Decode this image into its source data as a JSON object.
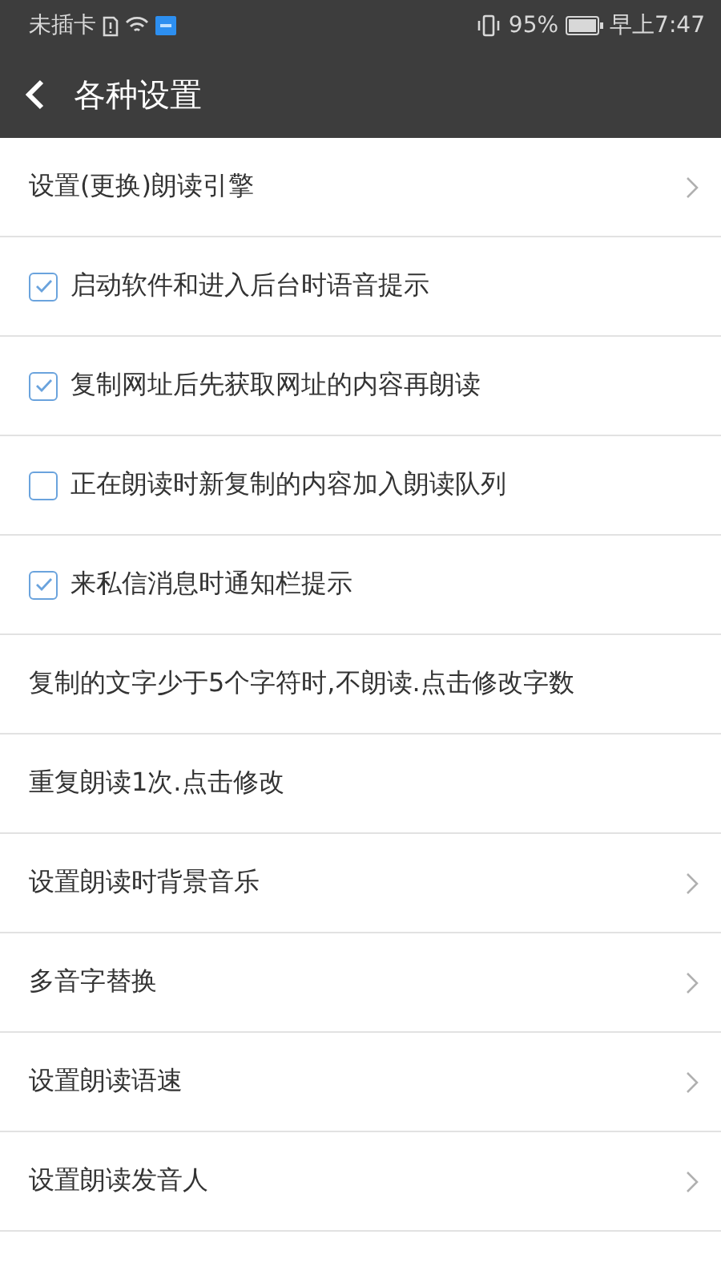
{
  "status_bar": {
    "carrier": "未插卡",
    "battery": "95%",
    "time": "早上7:47"
  },
  "toolbar": {
    "title": "各种设置"
  },
  "items": [
    {
      "kind": "link",
      "label": "设置(更换)朗读引擎"
    },
    {
      "kind": "check",
      "label": "启动软件和进入后台时语音提示",
      "checked": true
    },
    {
      "kind": "check",
      "label": "复制网址后先获取网址的内容再朗读",
      "checked": true
    },
    {
      "kind": "check",
      "label": "正在朗读时新复制的内容加入朗读队列",
      "checked": false
    },
    {
      "kind": "check",
      "label": "来私信消息时通知栏提示",
      "checked": true
    },
    {
      "kind": "plain",
      "label": "复制的文字少于5个字符时,不朗读.点击修改字数"
    },
    {
      "kind": "plain",
      "label": "重复朗读1次.点击修改"
    },
    {
      "kind": "link",
      "label": "设置朗读时背景音乐"
    },
    {
      "kind": "link",
      "label": "多音字替换"
    },
    {
      "kind": "link",
      "label": "设置朗读语速"
    },
    {
      "kind": "link",
      "label": "设置朗读发音人"
    }
  ]
}
